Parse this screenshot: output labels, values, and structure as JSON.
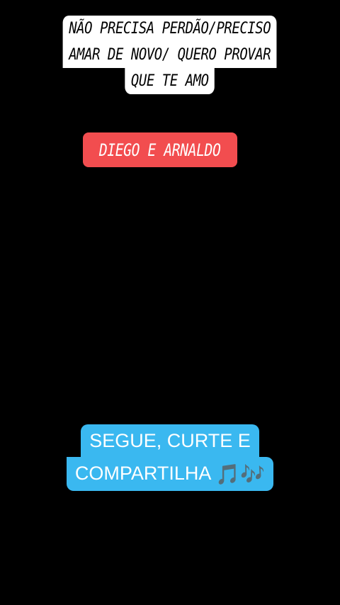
{
  "lyric": {
    "lines": [
      "NÃO PRECISA PERDÃO/PRECISO",
      "AMAR DE NOVO/ QUERO PROVAR",
      "QUE TE AMO"
    ]
  },
  "artist": {
    "label": "DIEGO E ARNALDO"
  },
  "cta": {
    "line1": "SEGUE, CURTE E",
    "line2": "COMPARTILHA",
    "icon": "music-notes-icon",
    "icon_glyph": "🎵🎶"
  },
  "colors": {
    "background": "#000000",
    "lyric_box": "#ffffff",
    "artist_tag": "#f24d4f",
    "cta_box": "#3ab8f0"
  }
}
